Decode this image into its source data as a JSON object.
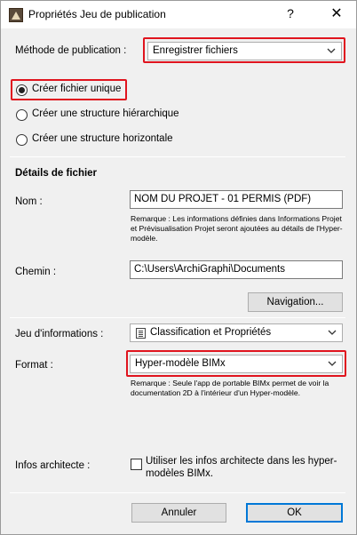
{
  "window": {
    "title": "Propriétés Jeu de publication",
    "help_glyph": "?",
    "close_glyph": "✕"
  },
  "publication": {
    "label": "Méthode de publication :",
    "value": "Enregistrer fichiers"
  },
  "structure": {
    "options": [
      {
        "label": "Créer fichier unique",
        "checked": true
      },
      {
        "label": "Créer une structure hiérarchique",
        "checked": false
      },
      {
        "label": "Créer une structure horizontale",
        "checked": false
      }
    ]
  },
  "details": {
    "heading": "Détails de fichier",
    "name_label": "Nom :",
    "name_value": "NOM DU PROJET - 01 PERMIS (PDF)",
    "name_note": "Remarque : Les informations définies dans Informations Projet et Prévisualisation Projet seront ajoutées au détails de l'Hyper-modèle.",
    "path_label": "Chemin :",
    "path_value": "C:\\Users\\ArchiGraphi\\Documents",
    "browse_label": "Navigation...",
    "infoset_label": "Jeu d'informations :",
    "infoset_value": "Classification et Propriétés",
    "format_label": "Format :",
    "format_value": "Hyper-modèle BIMx",
    "format_note": "Remarque : Seule l'app de portable BIMx permet de voir la documentation 2D à l'intérieur d'un Hyper-modèle.",
    "architect_label": "Infos architecte :",
    "architect_checkbox_label": "Utiliser les infos architecte dans les hyper-modèles BIMx."
  },
  "footer": {
    "cancel_label": "Annuler",
    "ok_label": "OK"
  },
  "colors": {
    "highlight": "#e0141e",
    "accent": "#0078d7"
  }
}
